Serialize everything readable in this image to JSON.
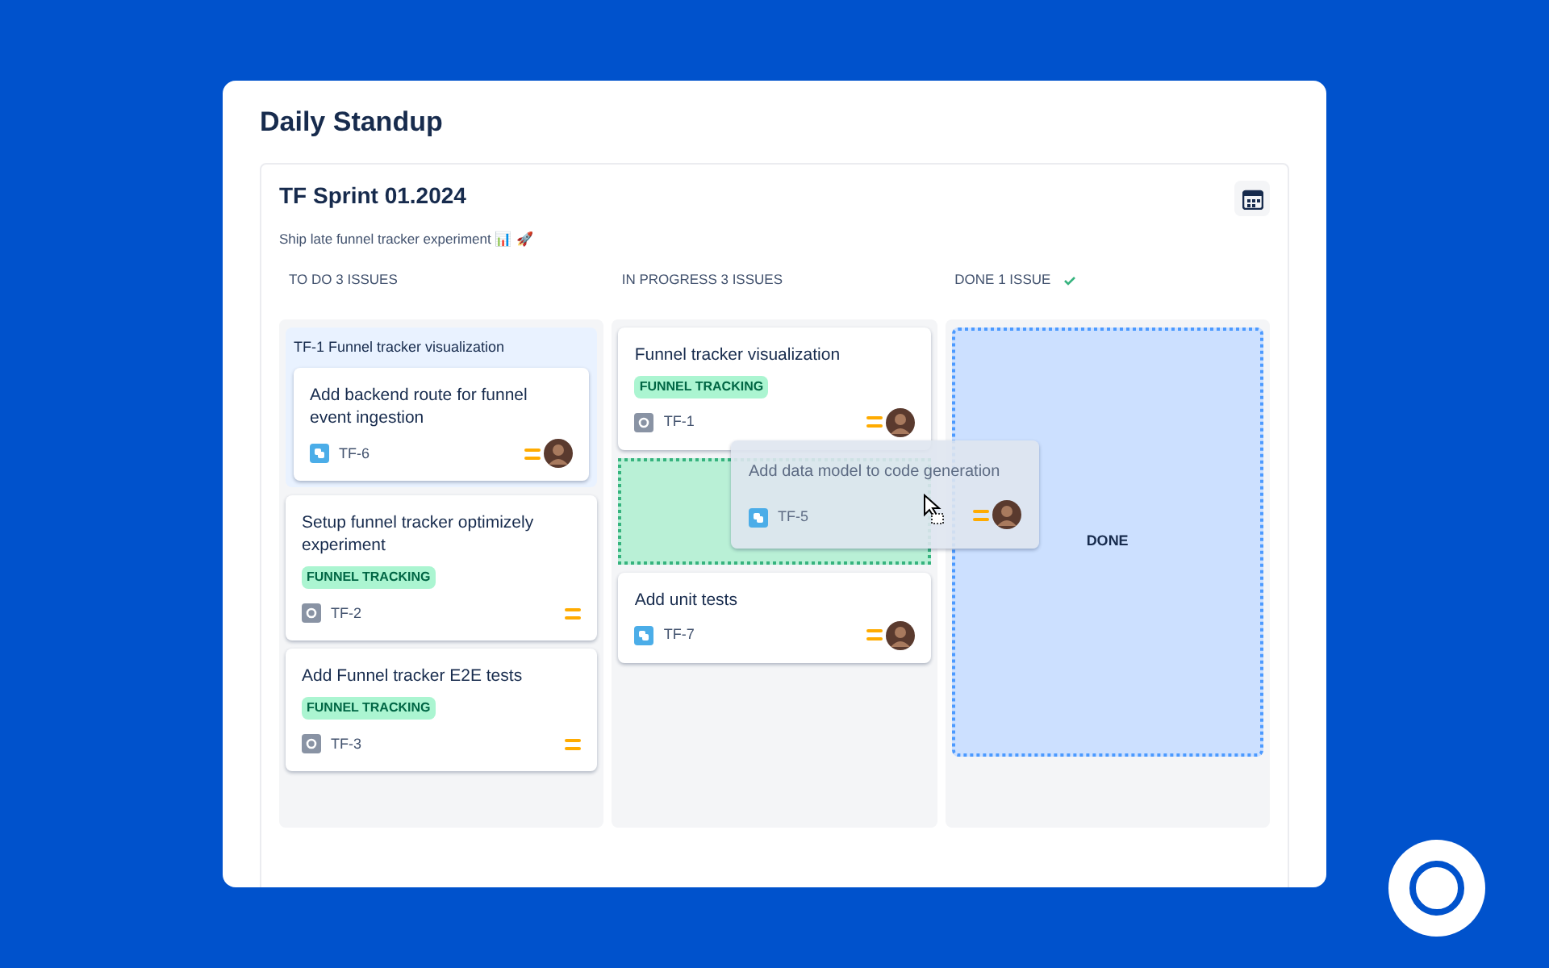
{
  "page": {
    "title": "Daily Standup"
  },
  "sprint": {
    "title": "TF Sprint 01.2024",
    "goal": "Ship late funnel tracker experiment 📊 🚀"
  },
  "columns": [
    {
      "title": "TO DO 3 ISSUES",
      "check": false,
      "items": [
        {
          "kind": "group",
          "title": "TF-1 Funnel tracker visualization",
          "cards": [
            {
              "kind": "story",
              "title": "Add backend route for funnel event ingestion",
              "key": "TF-6",
              "avatar": true
            }
          ]
        },
        {
          "kind": "task",
          "title": "Setup funnel tracker optimizely experiment",
          "label": "FUNNEL TRACKING",
          "key": "TF-2",
          "avatar": false
        },
        {
          "kind": "task",
          "title": "Add Funnel tracker E2E tests",
          "label": "FUNNEL TRACKING",
          "key": "TF-3",
          "avatar": false
        }
      ]
    },
    {
      "title": "IN PROGRESS 3 ISSUES",
      "check": false,
      "items": [
        {
          "kind": "task",
          "title": "Funnel tracker visualization",
          "label": "FUNNEL TRACKING",
          "key": "TF-1",
          "avatar": true
        },
        {
          "kind": "drop-zone"
        },
        {
          "kind": "story",
          "title": "Add unit tests",
          "key": "TF-7",
          "avatar": true
        }
      ]
    },
    {
      "title": "DONE 1 ISSUE",
      "check": true,
      "items": [
        {
          "kind": "done-zone",
          "label": "DONE"
        }
      ]
    }
  ],
  "dragged_card": {
    "kind": "story",
    "title": "Add data model to code generation",
    "key": "TF-5",
    "avatar": true
  }
}
